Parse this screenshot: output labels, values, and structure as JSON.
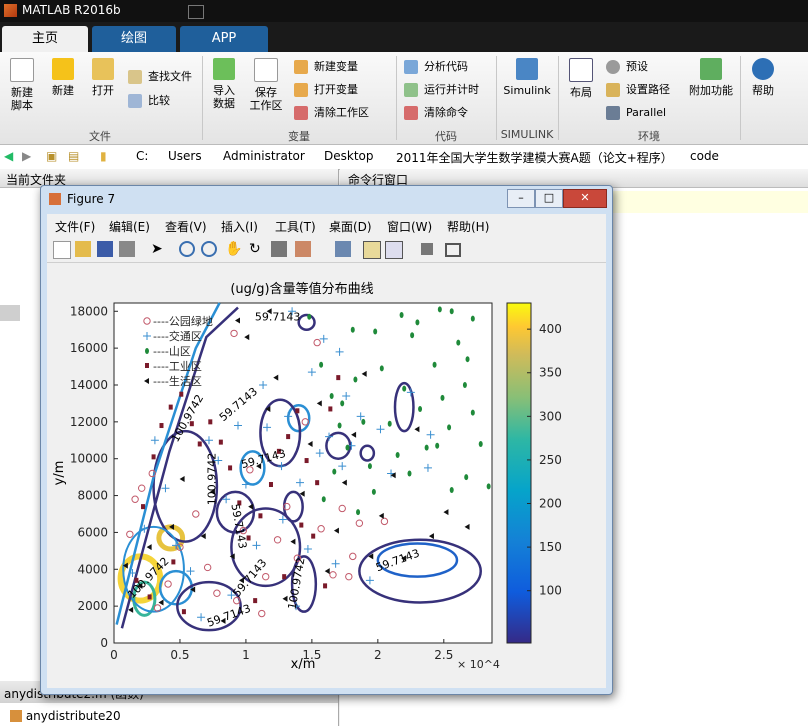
{
  "app": {
    "title": "MATLAB R2016b"
  },
  "tabs": [
    {
      "label": "主页",
      "active": true
    },
    {
      "label": "绘图",
      "active": false
    },
    {
      "label": "APP",
      "active": false
    }
  ],
  "ribbon": {
    "file": {
      "new_script": "新建\n脚本",
      "new": "新建",
      "open": "打开",
      "find_files": "查找文件",
      "compare": "比较",
      "group": "文件"
    },
    "variable": {
      "import": "导入\n数据",
      "save_ws": "保存\n工作区",
      "new_var": "新建变量",
      "open_var": "打开变量",
      "clear_ws": "清除工作区",
      "group": "变量"
    },
    "code": {
      "analyze": "分析代码",
      "run_time": "运行并计时",
      "clear_cmd": "清除命令",
      "group": "代码"
    },
    "simulink": {
      "label": "Simulink",
      "group": "SIMULINK"
    },
    "env": {
      "layout": "布局",
      "prefs": "预设",
      "set_path": "设置路径",
      "parallel": "Parallel",
      "addons": "附加功能",
      "group": "环境"
    },
    "resources": {
      "help": "帮助"
    }
  },
  "address": {
    "crumbs": [
      "C:",
      "Users",
      "Administrator",
      "Desktop",
      "2011年全国大学生数学建模大赛A题（论文+程序）",
      "code"
    ]
  },
  "left_pane": {
    "title": "当前文件夹",
    "bottom_item": "anydistribute2.m  (函数)",
    "bottom_item2": "anydistribute20"
  },
  "cmd_pane": {
    "title": "命令行窗口"
  },
  "figure": {
    "title": "Figure 7",
    "menu": [
      "文件(F)",
      "编辑(E)",
      "查看(V)",
      "插入(I)",
      "工具(T)",
      "桌面(D)",
      "窗口(W)",
      "帮助(H)"
    ],
    "window_controls": {
      "minimize": "–",
      "maximize": "□",
      "close": "✕"
    }
  },
  "chart_data": {
    "type": "scatter",
    "title": "(ug/g)含量等值分布曲线",
    "xlabel": "x/m",
    "ylabel": "y/m",
    "x_multiplier": "× 10^4",
    "xlim": [
      0,
      28654
    ],
    "ylim": [
      0,
      18449
    ],
    "xticks": [
      "0",
      "0.5",
      "1",
      "1.5",
      "2",
      "2.5"
    ],
    "yticks": [
      "0",
      "2000",
      "4000",
      "6000",
      "8000",
      "10000",
      "12000",
      "14000",
      "16000",
      "18000"
    ],
    "colorbar": {
      "min": 40,
      "max": 430,
      "ticks": [
        "100",
        "150",
        "200",
        "250",
        "300",
        "350",
        "400"
      ]
    },
    "contour_labels": [
      "59.7143",
      "59.7143",
      "59.7143",
      "59.7143",
      "59.7143",
      "59.7143",
      "59.7143",
      "100.9742",
      "100.9742",
      "100.9742",
      "100.9742"
    ],
    "legend": [
      {
        "label": "----公园绿地",
        "marker": "circle",
        "color": "#c25a6b"
      },
      {
        "label": "----交通区",
        "marker": "plus",
        "color": "#3a8fd0"
      },
      {
        "label": "----山区",
        "marker": "dot",
        "color": "#1f8a3a"
      },
      {
        "label": "----工业区",
        "marker": "square",
        "color": "#7a1a2a"
      },
      {
        "label": "----生活区",
        "marker": "triangle",
        "color": "#111111"
      }
    ],
    "series": [
      {
        "name": "公园绿地",
        "points": [
          [
            1200,
            5900
          ],
          [
            1600,
            7800
          ],
          [
            2100,
            8400
          ],
          [
            2900,
            9200
          ],
          [
            3300,
            1900
          ],
          [
            4100,
            3200
          ],
          [
            5000,
            5200
          ],
          [
            6200,
            7000
          ],
          [
            7100,
            4100
          ],
          [
            7800,
            2700
          ],
          [
            9300,
            2300
          ],
          [
            9800,
            6100
          ],
          [
            10300,
            9400
          ],
          [
            11200,
            1600
          ],
          [
            11500,
            3600
          ],
          [
            12400,
            5600
          ],
          [
            13100,
            7400
          ],
          [
            13900,
            4600
          ],
          [
            14500,
            12000
          ],
          [
            15700,
            6200
          ],
          [
            15400,
            16300
          ],
          [
            16600,
            3700
          ],
          [
            17300,
            7300
          ],
          [
            17800,
            3600
          ],
          [
            18100,
            4700
          ],
          [
            18600,
            6500
          ],
          [
            20500,
            6600
          ],
          [
            9100,
            16800
          ]
        ]
      },
      {
        "name": "交通区",
        "points": [
          [
            1400,
            3800
          ],
          [
            2300,
            6200
          ],
          [
            3100,
            11000
          ],
          [
            3900,
            8400
          ],
          [
            4700,
            5300
          ],
          [
            5800,
            3900
          ],
          [
            6600,
            1400
          ],
          [
            7200,
            11000
          ],
          [
            7900,
            9900
          ],
          [
            8500,
            7800
          ],
          [
            8900,
            2600
          ],
          [
            10000,
            8600
          ],
          [
            10800,
            5300
          ],
          [
            11300,
            14000
          ],
          [
            11600,
            11700
          ],
          [
            12700,
            9600
          ],
          [
            13200,
            12300
          ],
          [
            13800,
            2000
          ],
          [
            14100,
            8700
          ],
          [
            14700,
            5100
          ],
          [
            15000,
            14700
          ],
          [
            15600,
            10300
          ],
          [
            15900,
            16500
          ],
          [
            16300,
            11200
          ],
          [
            16800,
            4300
          ],
          [
            17300,
            9600
          ],
          [
            17600,
            13400
          ],
          [
            18000,
            10700
          ],
          [
            18700,
            12300
          ],
          [
            19400,
            3400
          ],
          [
            20200,
            11600
          ],
          [
            21000,
            9200
          ],
          [
            22500,
            13600
          ],
          [
            24000,
            11300
          ],
          [
            23800,
            9500
          ],
          [
            12800,
            6700
          ],
          [
            9400,
            11800
          ],
          [
            13500,
            18000
          ],
          [
            17100,
            15800
          ]
        ]
      },
      {
        "name": "山区",
        "points": [
          [
            14800,
            17700
          ],
          [
            15700,
            15100
          ],
          [
            16500,
            13400
          ],
          [
            17100,
            11800
          ],
          [
            17700,
            10600
          ],
          [
            18300,
            14300
          ],
          [
            18900,
            12000
          ],
          [
            19400,
            9600
          ],
          [
            19800,
            16900
          ],
          [
            20300,
            14900
          ],
          [
            20900,
            11900
          ],
          [
            21500,
            10200
          ],
          [
            22000,
            13800
          ],
          [
            22600,
            16700
          ],
          [
            23200,
            12700
          ],
          [
            23700,
            10600
          ],
          [
            24300,
            15100
          ],
          [
            24900,
            13300
          ],
          [
            25400,
            11700
          ],
          [
            26100,
            16300
          ],
          [
            26600,
            14000
          ],
          [
            27200,
            12500
          ],
          [
            27800,
            10800
          ],
          [
            21800,
            17800
          ],
          [
            23000,
            17400
          ],
          [
            24700,
            18100
          ],
          [
            25600,
            18000
          ],
          [
            27200,
            17600
          ],
          [
            28400,
            8500
          ],
          [
            26700,
            9000
          ],
          [
            25600,
            8300
          ],
          [
            24500,
            10700
          ],
          [
            22400,
            9200
          ],
          [
            19700,
            8200
          ],
          [
            18500,
            7100
          ],
          [
            16700,
            9300
          ],
          [
            15900,
            7800
          ],
          [
            17300,
            13000
          ],
          [
            18100,
            17000
          ],
          [
            26800,
            15400
          ]
        ]
      },
      {
        "name": "工业区",
        "points": [
          [
            2200,
            7400
          ],
          [
            3000,
            10100
          ],
          [
            3600,
            11800
          ],
          [
            4300,
            12800
          ],
          [
            5100,
            13500
          ],
          [
            5900,
            11900
          ],
          [
            6500,
            10800
          ],
          [
            7300,
            12000
          ],
          [
            8100,
            10900
          ],
          [
            8800,
            9500
          ],
          [
            9500,
            7600
          ],
          [
            10200,
            5700
          ],
          [
            11100,
            6900
          ],
          [
            11900,
            8600
          ],
          [
            12500,
            10400
          ],
          [
            13200,
            11200
          ],
          [
            13900,
            12600
          ],
          [
            14600,
            9900
          ],
          [
            15400,
            8700
          ],
          [
            16400,
            12700
          ],
          [
            17000,
            14400
          ],
          [
            14200,
            6400
          ],
          [
            15100,
            5800
          ],
          [
            16000,
            3100
          ],
          [
            12900,
            3600
          ],
          [
            10700,
            2300
          ],
          [
            4500,
            4400
          ],
          [
            5300,
            1700
          ],
          [
            2700,
            2500
          ],
          [
            1700,
            3400
          ]
        ]
      },
      {
        "name": "生活区",
        "points": [
          [
            900,
            4200
          ],
          [
            1300,
            1800
          ],
          [
            2000,
            3100
          ],
          [
            2700,
            5200
          ],
          [
            3600,
            2200
          ],
          [
            4400,
            6300
          ],
          [
            5200,
            8900
          ],
          [
            6000,
            2900
          ],
          [
            6800,
            5800
          ],
          [
            7500,
            8200
          ],
          [
            8300,
            1200
          ],
          [
            9000,
            4700
          ],
          [
            9700,
            3400
          ],
          [
            10400,
            7400
          ],
          [
            11000,
            9600
          ],
          [
            11700,
            12700
          ],
          [
            12300,
            14400
          ],
          [
            13000,
            2400
          ],
          [
            13600,
            5500
          ],
          [
            14300,
            8100
          ],
          [
            14900,
            10800
          ],
          [
            15600,
            13000
          ],
          [
            16200,
            3900
          ],
          [
            16900,
            6100
          ],
          [
            17500,
            8700
          ],
          [
            18200,
            11300
          ],
          [
            19000,
            14600
          ],
          [
            19500,
            4700
          ],
          [
            20300,
            6900
          ],
          [
            21200,
            9100
          ],
          [
            22000,
            4600
          ],
          [
            23000,
            11600
          ],
          [
            24100,
            5800
          ],
          [
            25200,
            7100
          ],
          [
            26800,
            6300
          ],
          [
            10100,
            16600
          ],
          [
            9400,
            17500
          ],
          [
            11800,
            18000
          ]
        ]
      }
    ]
  }
}
